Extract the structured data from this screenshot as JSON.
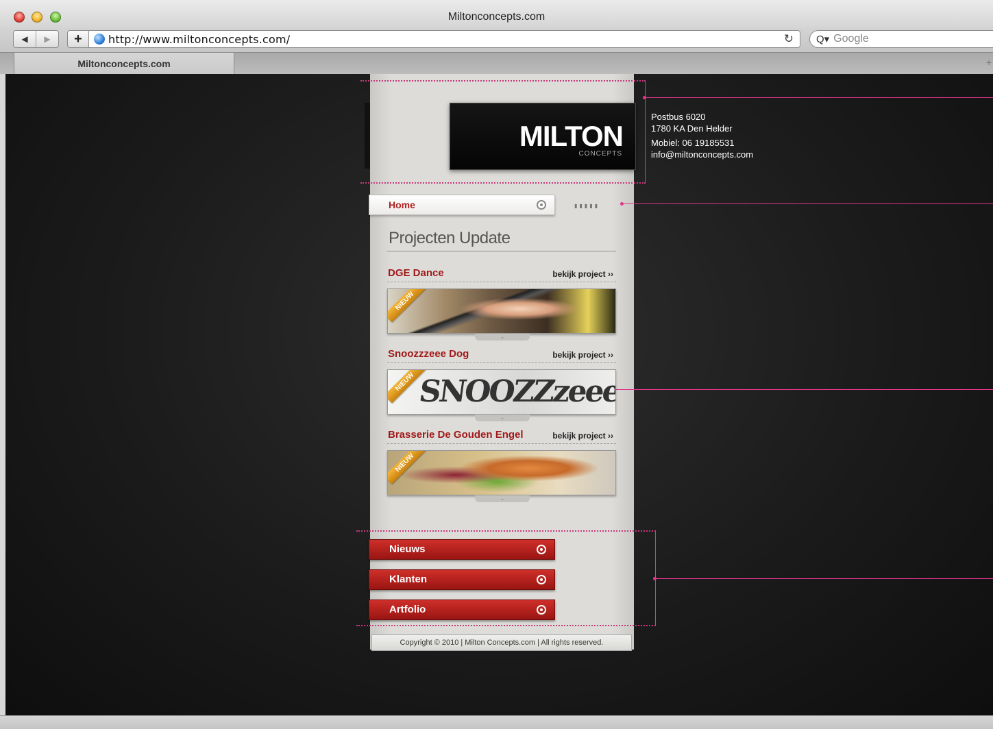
{
  "window": {
    "title": "Miltonconcepts.com"
  },
  "toolbar": {
    "back_label": "◀",
    "forward_label": "▶",
    "add_label": "+",
    "url": "http://www.miltonconcepts.com/",
    "reload_label": "↻",
    "search_placeholder": "Google",
    "search_icon": "Q▾"
  },
  "tab": {
    "label": "Miltonconcepts.com",
    "new_tab_icon": "+"
  },
  "site": {
    "logo": {
      "main": "MILTON",
      "sub": "CONCEPTS"
    },
    "contact": {
      "address_line1": "Postbus 6020",
      "address_line2": "1780 KA Den Helder",
      "phone": "Mobiel: 06 19185531",
      "email": "info@miltonconcepts.com"
    },
    "nav_home": "Home",
    "section_title": "Projecten Update",
    "projects": [
      {
        "name": "DGE Dance",
        "link": "bekijk project ››",
        "badge": "NIEUW"
      },
      {
        "name": "Snoozzzeee Dog",
        "link": "bekijk project ››",
        "badge": "NIEUW",
        "image_text": "SNOOZZzeee"
      },
      {
        "name": "Brasserie De Gouden Engel",
        "link": "bekijk project ››",
        "badge": "NIEUW"
      }
    ],
    "menu": [
      "Nieuws",
      "Klanten",
      "Artfolio"
    ],
    "footer": "Copyright © 2010 | Milton Concepts.com | All rights reserved.",
    "colors": {
      "accent_red": "#b01f1f",
      "annotation_pink": "#e0378a",
      "badge_orange": "#e9a22a"
    }
  }
}
